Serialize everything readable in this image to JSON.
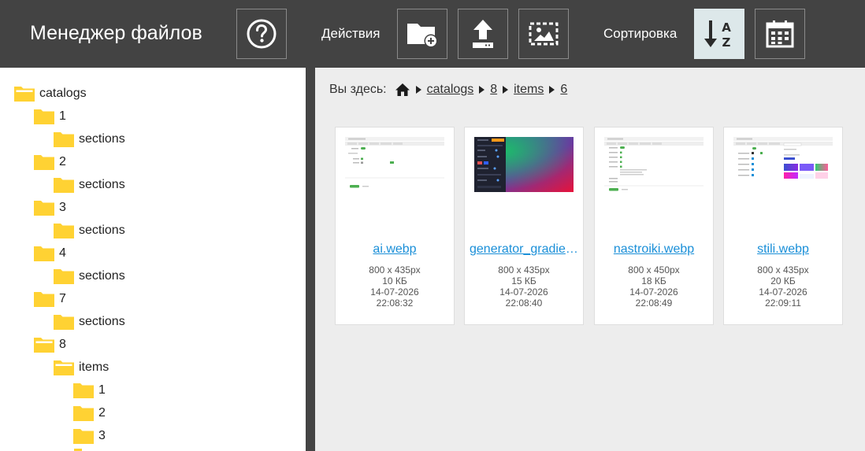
{
  "header": {
    "title": "Менеджер файлов",
    "actions_label": "Действия",
    "sort_label": "Сортировка",
    "buttons": [
      {
        "name": "help-button",
        "icon": "question-circle-icon"
      },
      {
        "name": "new-folder-button",
        "icon": "folder-plus-icon"
      },
      {
        "name": "upload-button",
        "icon": "upload-icon"
      },
      {
        "name": "select-image-button",
        "icon": "image-select-icon"
      },
      {
        "name": "sort-alpha-button",
        "icon": "sort-alpha-az-icon",
        "active": true
      },
      {
        "name": "sort-date-button",
        "icon": "calendar-icon"
      }
    ]
  },
  "tree": [
    {
      "label": "catalogs",
      "level": 0,
      "open": true
    },
    {
      "label": "1",
      "level": 1,
      "open": false
    },
    {
      "label": "sections",
      "level": 2,
      "open": false
    },
    {
      "label": "2",
      "level": 1,
      "open": false
    },
    {
      "label": "sections",
      "level": 2,
      "open": false
    },
    {
      "label": "3",
      "level": 1,
      "open": false
    },
    {
      "label": "sections",
      "level": 2,
      "open": false
    },
    {
      "label": "4",
      "level": 1,
      "open": false
    },
    {
      "label": "sections",
      "level": 2,
      "open": false
    },
    {
      "label": "7",
      "level": 1,
      "open": false
    },
    {
      "label": "sections",
      "level": 2,
      "open": false
    },
    {
      "label": "8",
      "level": 1,
      "open": true
    },
    {
      "label": "items",
      "level": 2,
      "open": true
    },
    {
      "label": "1",
      "level": 3,
      "open": false
    },
    {
      "label": "2",
      "level": 3,
      "open": false
    },
    {
      "label": "3",
      "level": 3,
      "open": false
    }
  ],
  "breadcrumb": {
    "prefix": "Вы здесь:",
    "items": [
      "catalogs",
      "8",
      "items",
      "6"
    ]
  },
  "files": [
    {
      "name": "ai.webp",
      "dims": "800 x 435px",
      "size": "10 КБ",
      "date": "14-07-2026",
      "time": "22:08:32",
      "thumb": "settings-ui"
    },
    {
      "name": "generator_gradient.webp",
      "dims": "800 x 435px",
      "size": "15 КБ",
      "date": "14-07-2026",
      "time": "22:08:40",
      "thumb": "gradient-generator"
    },
    {
      "name": "nastroiki.webp",
      "dims": "800 x 450px",
      "size": "18 КБ",
      "date": "14-07-2026",
      "time": "22:08:49",
      "thumb": "settings-list"
    },
    {
      "name": "stili.webp",
      "dims": "800 x 435px",
      "size": "20 КБ",
      "date": "14-07-2026",
      "time": "22:09:11",
      "thumb": "styles-palette"
    }
  ],
  "colors": {
    "header_bg": "#434343",
    "folder": "#ffd233",
    "link": "#1a8fd8",
    "active_button": "#dde8ea"
  }
}
